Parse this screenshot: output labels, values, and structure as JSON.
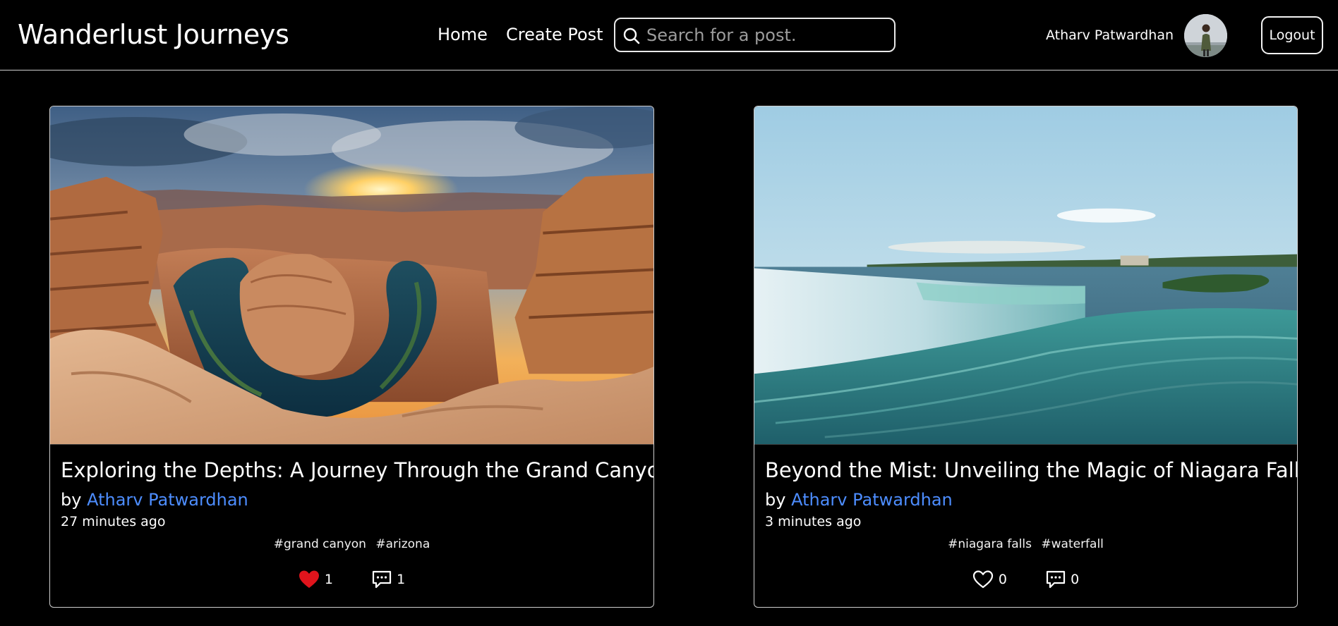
{
  "app": {
    "brand": "Wanderlust Journeys"
  },
  "nav": {
    "home_label": "Home",
    "create_label": "Create Post"
  },
  "search": {
    "placeholder": "Search for a post.",
    "value": ""
  },
  "user": {
    "name": "Atharv Patwardhan",
    "logout_label": "Logout"
  },
  "colors": {
    "background": "#000000",
    "text": "#ffffff",
    "author_link": "#4d8dff",
    "liked_heart": "#e0141c",
    "border": "#cfcfcf"
  },
  "posts": [
    {
      "title": "Exploring the Depths: A Journey Through the Grand Canyon",
      "by_label": "by",
      "author": "Atharv Patwardhan",
      "time": "27 minutes ago",
      "tags": [
        "#grand canyon",
        "#arizona"
      ],
      "likes": "1",
      "liked": true,
      "comments": "1",
      "image_icon": "grand-canyon-photo"
    },
    {
      "title": "Beyond the Mist: Unveiling the Magic of Niagara Falls",
      "by_label": "by",
      "author": "Atharv Patwardhan",
      "time": "3 minutes ago",
      "tags": [
        "#niagara falls",
        "#waterfall"
      ],
      "likes": "0",
      "liked": false,
      "comments": "0",
      "image_icon": "niagara-falls-photo"
    }
  ]
}
